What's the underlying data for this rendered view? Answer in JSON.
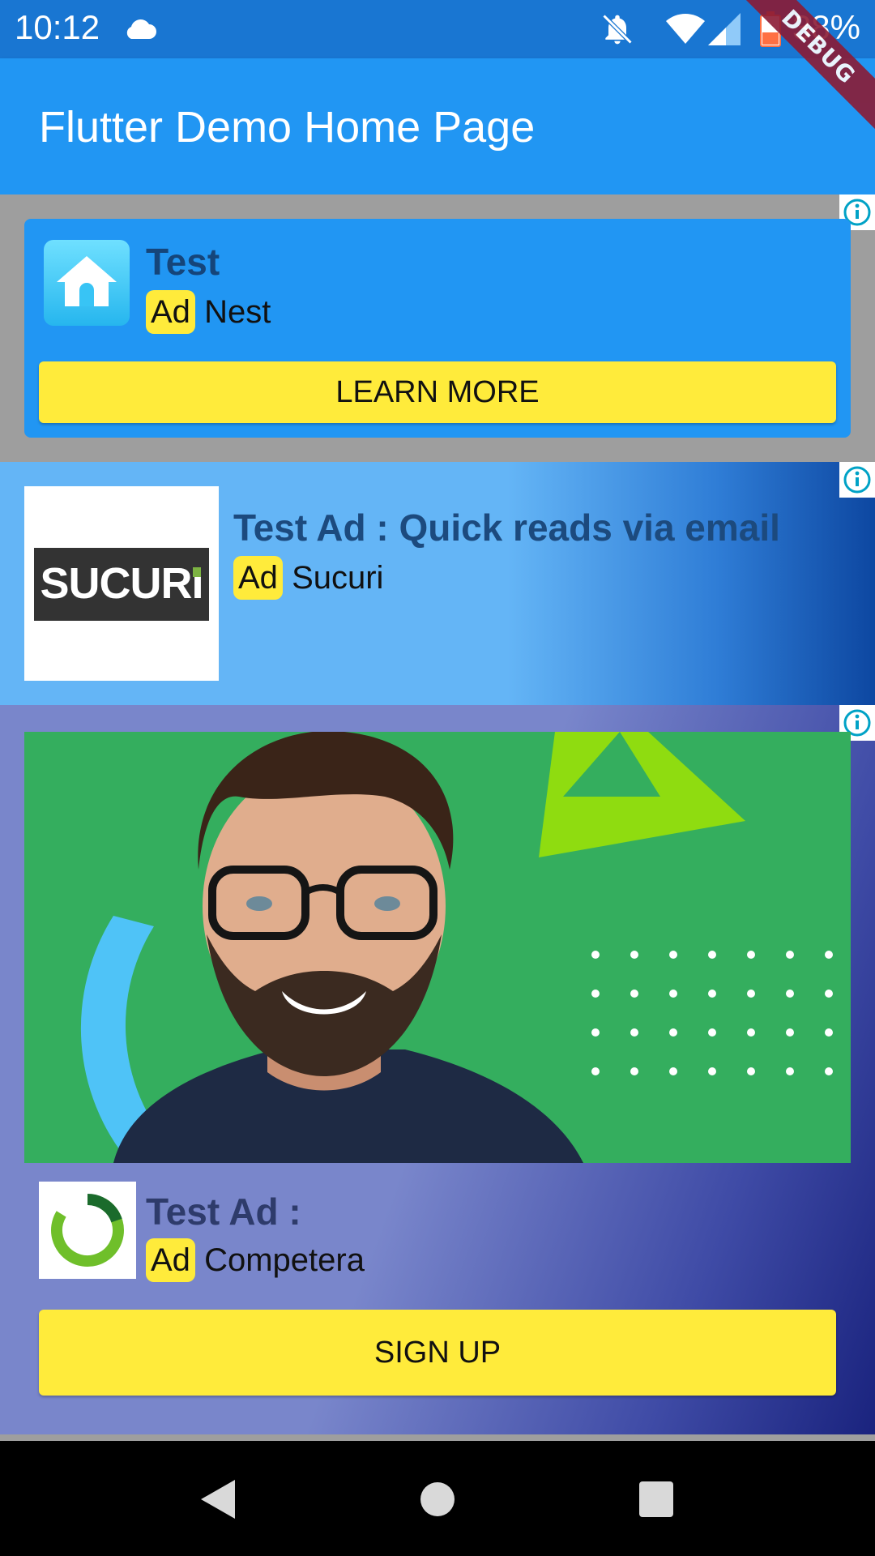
{
  "status_bar": {
    "time": "10:12",
    "battery_percent": "38%",
    "icons": [
      "cloud-icon",
      "notifications-off-icon",
      "wifi-icon",
      "cell-signal-icon",
      "battery-icon"
    ]
  },
  "debug_banner": "DEBUG",
  "app_bar": {
    "title": "Flutter Demo Home Page",
    "color": "#2196f3"
  },
  "ads": [
    {
      "headline": "Test",
      "badge": "Ad",
      "advertiser": "Nest",
      "cta": "LEARN MORE",
      "icon": "home-icon",
      "card_color": "#2196f3"
    },
    {
      "headline": "Test Ad : Quick reads via email",
      "badge": "Ad",
      "advertiser": "Sucuri",
      "logo_text": "SUCURI",
      "icon": "sucuri-logo"
    },
    {
      "headline": "Test Ad :",
      "badge": "Ad",
      "advertiser": "Competera",
      "cta": "SIGN UP",
      "icon": "competera-logo",
      "media": "smiling-man-photo"
    }
  ],
  "colors": {
    "accent_yellow": "#ffeb3b",
    "status_bar": "#1976d2"
  },
  "nav_bar": {
    "buttons": [
      "back-icon",
      "home-icon",
      "recents-icon"
    ]
  }
}
